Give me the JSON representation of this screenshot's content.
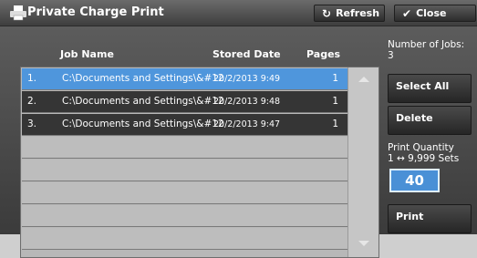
{
  "window": {
    "title": "Private Charge Print",
    "refresh_label": "Refresh",
    "close_label": "Close"
  },
  "table": {
    "headers": {
      "job_name": "Job Name",
      "stored_date": "Stored Date",
      "pages": "Pages"
    },
    "rows": [
      {
        "num": "1.",
        "name": "C:\\Documents and Settings\\&#12",
        "date": "20/2/2013 9:49",
        "pages": "1",
        "selected": true
      },
      {
        "num": "2.",
        "name": "C:\\Documents and Settings\\&#12",
        "date": "20/2/2013 9:48",
        "pages": "1",
        "selected": false
      },
      {
        "num": "3.",
        "name": "C:\\Documents and Settings\\&#12",
        "date": "20/2/2013 9:47",
        "pages": "1",
        "selected": false
      }
    ]
  },
  "side": {
    "jobs_label": "Number of Jobs:",
    "jobs_count": "3",
    "select_all": "Select All",
    "delete": "Delete",
    "quantity_label": "Print Quantity",
    "quantity_range": "1 ↔ 9,999 Sets",
    "quantity_value": "40",
    "print": "Print"
  },
  "colors": {
    "selected_row": "#4f96dc",
    "accent": "#4a90d6"
  }
}
